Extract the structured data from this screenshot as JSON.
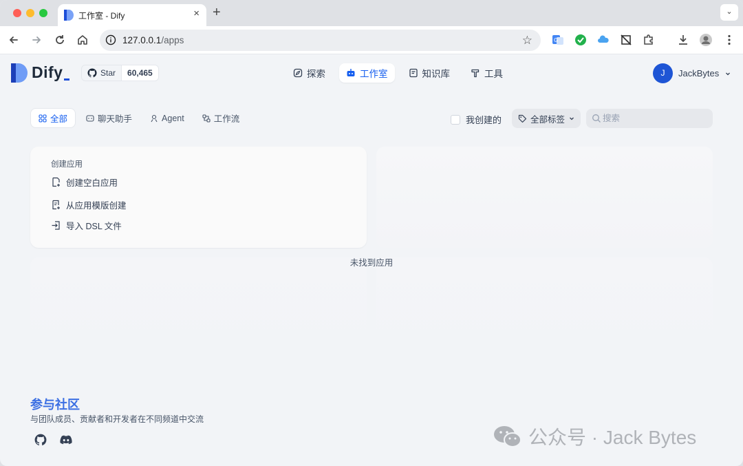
{
  "browser": {
    "tab_title": "工作室 - Dify",
    "url_host": "127.0.0.1",
    "url_path": "/apps"
  },
  "app": {
    "logo_text": "Dify",
    "github": {
      "star_label": "Star",
      "star_count": "60,465"
    },
    "nav": {
      "explore": "探索",
      "studio": "工作室",
      "knowledge": "知识库",
      "tools": "工具"
    },
    "user": {
      "initial": "J",
      "name": "JackBytes"
    }
  },
  "filters": {
    "tabs": {
      "all": "全部",
      "chat": "聊天助手",
      "agent": "Agent",
      "workflow": "工作流"
    },
    "created_by_me": "我创建的",
    "tags": "全部标签",
    "search_placeholder": "搜索"
  },
  "create_card": {
    "title": "创建应用",
    "blank": "创建空白应用",
    "template": "从应用模版创建",
    "import": "导入 DSL 文件"
  },
  "empty_text": "未找到应用",
  "footer": {
    "title": "参与社区",
    "description": "与团队成员、贡献者和开发者在不同频道中交流"
  },
  "watermark": "公众号 · Jack Bytes",
  "colors": {
    "accent": "#155eef",
    "avatar": "#1e55d5",
    "page_bg": "#f2f4f7"
  }
}
